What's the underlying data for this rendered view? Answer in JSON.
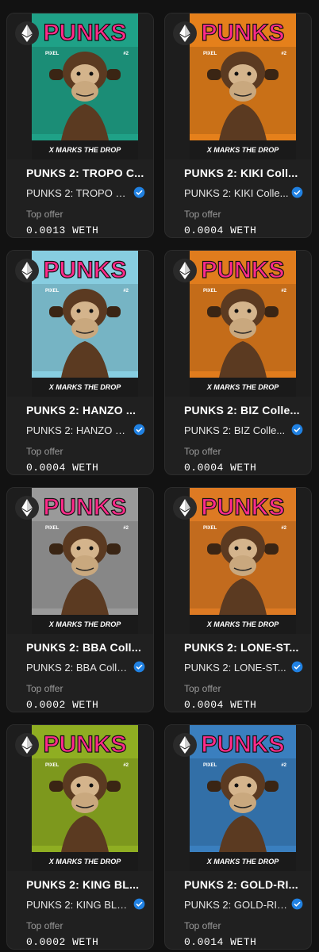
{
  "cards": [
    {
      "title": "PUNKS 2: TROPO C...",
      "collection": "PUNKS 2: TROPO C...",
      "offer_label": "Top offer",
      "price": "0.0013 WETH",
      "bg": "#1fa187"
    },
    {
      "title": "PUNKS 2: KIKI Coll...",
      "collection": "PUNKS 2: KIKI Colle...",
      "offer_label": "Top offer",
      "price": "0.0004 WETH",
      "bg": "#e5801b"
    },
    {
      "title": "PUNKS 2: HANZO ...",
      "collection": "PUNKS 2: HANZO C...",
      "offer_label": "Top offer",
      "price": "0.0004 WETH",
      "bg": "#87cde0"
    },
    {
      "title": "PUNKS 2: BIZ Colle...",
      "collection": "PUNKS 2: BIZ Colle...",
      "offer_label": "Top offer",
      "price": "0.0004 WETH",
      "bg": "#e07c1d"
    },
    {
      "title": "PUNKS 2: BBA Coll...",
      "collection": "PUNKS 2: BBA Colle...",
      "offer_label": "Top offer",
      "price": "0.0002 WETH",
      "bg": "#9a9a9a"
    },
    {
      "title": "PUNKS 2: LONE-ST...",
      "collection": "PUNKS 2: LONE-ST...",
      "offer_label": "Top offer",
      "price": "0.0004 WETH",
      "bg": "#dd7a23"
    },
    {
      "title": "PUNKS 2: KING BL...",
      "collection": "PUNKS 2: KING BLA...",
      "offer_label": "Top offer",
      "price": "0.0002 WETH",
      "bg": "#8fae22"
    },
    {
      "title": "PUNKS 2: GOLD-RI...",
      "collection": "PUNKS 2: GOLD-RIL...",
      "offer_label": "Top offer",
      "price": "0.0014 WETH",
      "bg": "#3a7fbf"
    }
  ],
  "poster": {
    "logo": "PUNKS",
    "tagline": "X MARKS THE DROP",
    "issue": "#2",
    "brand": "PIXEL"
  }
}
